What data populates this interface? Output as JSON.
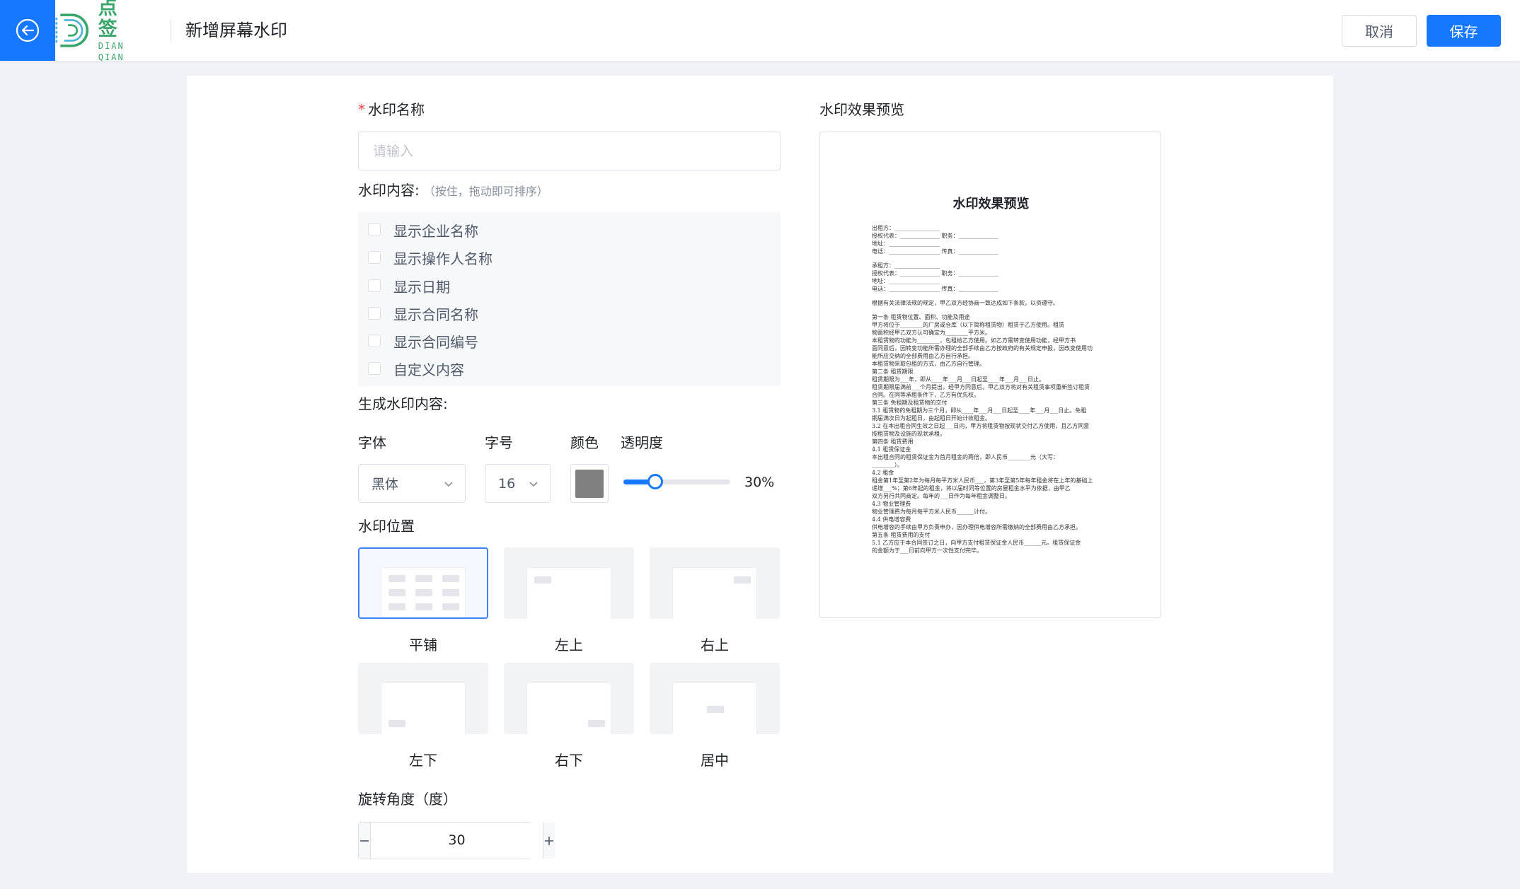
{
  "header": {
    "logo_cn": "点 签",
    "logo_en": "DIAN QIAN",
    "title": "新增屏幕水印",
    "cancel_label": "取消",
    "save_label": "保存",
    "accent_color": "#1677ff"
  },
  "form": {
    "name_label": "水印名称",
    "name_placeholder": "请输入",
    "name_value": "",
    "content_label": "水印内容:",
    "content_hint": "（按住，拖动即可排序）",
    "content_options": [
      {
        "label": "显示企业名称",
        "checked": false
      },
      {
        "label": "显示操作人名称",
        "checked": false
      },
      {
        "label": "显示日期",
        "checked": false
      },
      {
        "label": "显示合同名称",
        "checked": false
      },
      {
        "label": "显示合同编号",
        "checked": false
      },
      {
        "label": "自定义内容",
        "checked": false
      }
    ],
    "generated_label": "生成水印内容:",
    "font_label": "字体",
    "font_value": "黑体",
    "size_label": "字号",
    "size_value": "16",
    "color_label": "颜色",
    "color_value": "#808080",
    "opacity_label": "透明度",
    "opacity_percent": 30,
    "opacity_text": "30%",
    "position_label": "水印位置",
    "positions": [
      {
        "label": "平铺",
        "selected": true
      },
      {
        "label": "左上",
        "selected": false
      },
      {
        "label": "右上",
        "selected": false
      },
      {
        "label": "左下",
        "selected": false
      },
      {
        "label": "右下",
        "selected": false
      },
      {
        "label": "居中",
        "selected": false
      }
    ],
    "rotation_label": "旋转角度（度）",
    "rotation_value": "30"
  },
  "preview": {
    "label": "水印效果预览",
    "doc_title": "水印效果预览",
    "doc_lines": [
      "出租方：________________",
      "授权代表：______________ 职务：______________",
      "地址：__________________",
      "电话：__________________ 传真：______________",
      "承租方：________________",
      "授权代表：______________ 职务：______________",
      "地址：__________________",
      "电话：__________________ 传真：______________",
      "根据有关法律法规的规定，甲乙双方经协商一致达成如下条款，以资遵守。",
      "第一条 租赁物位置、面积、功能及用途",
      "甲方将位于________的厂房或仓库（以下简称租赁物）租赁于乙方使用。租赁",
      "物面积经甲乙双方认可确定为________平方米。",
      "本租赁物的功能为________，包租给乙方使用。如乙方需转变使用功能，经甲方书",
      "面同意后，因转变功能所需办理的全部手续由乙方按政府的有关规定申报，因改变使用功",
      "能所应交纳的全部费用由乙方自行承担。",
      "本租赁物采取包租的方式，由乙方自行管理。",
      "第二条 租赁期限",
      "租赁期限为___年，即从____年___月___日起至____年___月___日止。",
      "租赁期限届满前___个月提出，经甲方同意后，甲乙双方将对有关租赁事项重新签订租赁",
      "合同。在同等承租条件下，乙方有优先权。",
      "第三条 免租期及租赁物的交付",
      "3.1 租赁物的免租期为三个月，即从____年___月___日起至____年___月___日止。免租",
      "期届满次日为起租日，由起租日开始计收租金。",
      "3.2 在本出租合同生效之日起___日内，甲方将租赁物按现状交付乙方使用，且乙方同意",
      "按租赁物及设施的现状承租。",
      "第四条 租赁费用",
      "4.1 租赁保证金",
      "本出租合同的租赁保证金为首月租金的两倍，即人民币________元（大写：",
      "________）。",
      "4.2 租金",
      "租金第1年至第2年为每月每平方米人民币___，第3年至第5年每年租金将在上年的基础上",
      "递增___%；第6年起的租金，将以届时同等位置的房屋租金水平为依据，由甲乙",
      "双方另行共同商定。每年的___日作为每年租金调整日。",
      "4.3 物业管理费",
      "物业管理费为每月每平方米人民币______计付。",
      "4.4 供电增容费",
      "供电增容的手续由甲方负责申办，因办理供电增容所需缴纳的全部费用由乙方承担。",
      "第五条 租赁费用的支付",
      "5.1 乙方应于本合同签订之日，向甲方支付租赁保证金人民币______元。租赁保证金",
      "的金额为于___日前向甲方一次性支付完毕。"
    ]
  }
}
